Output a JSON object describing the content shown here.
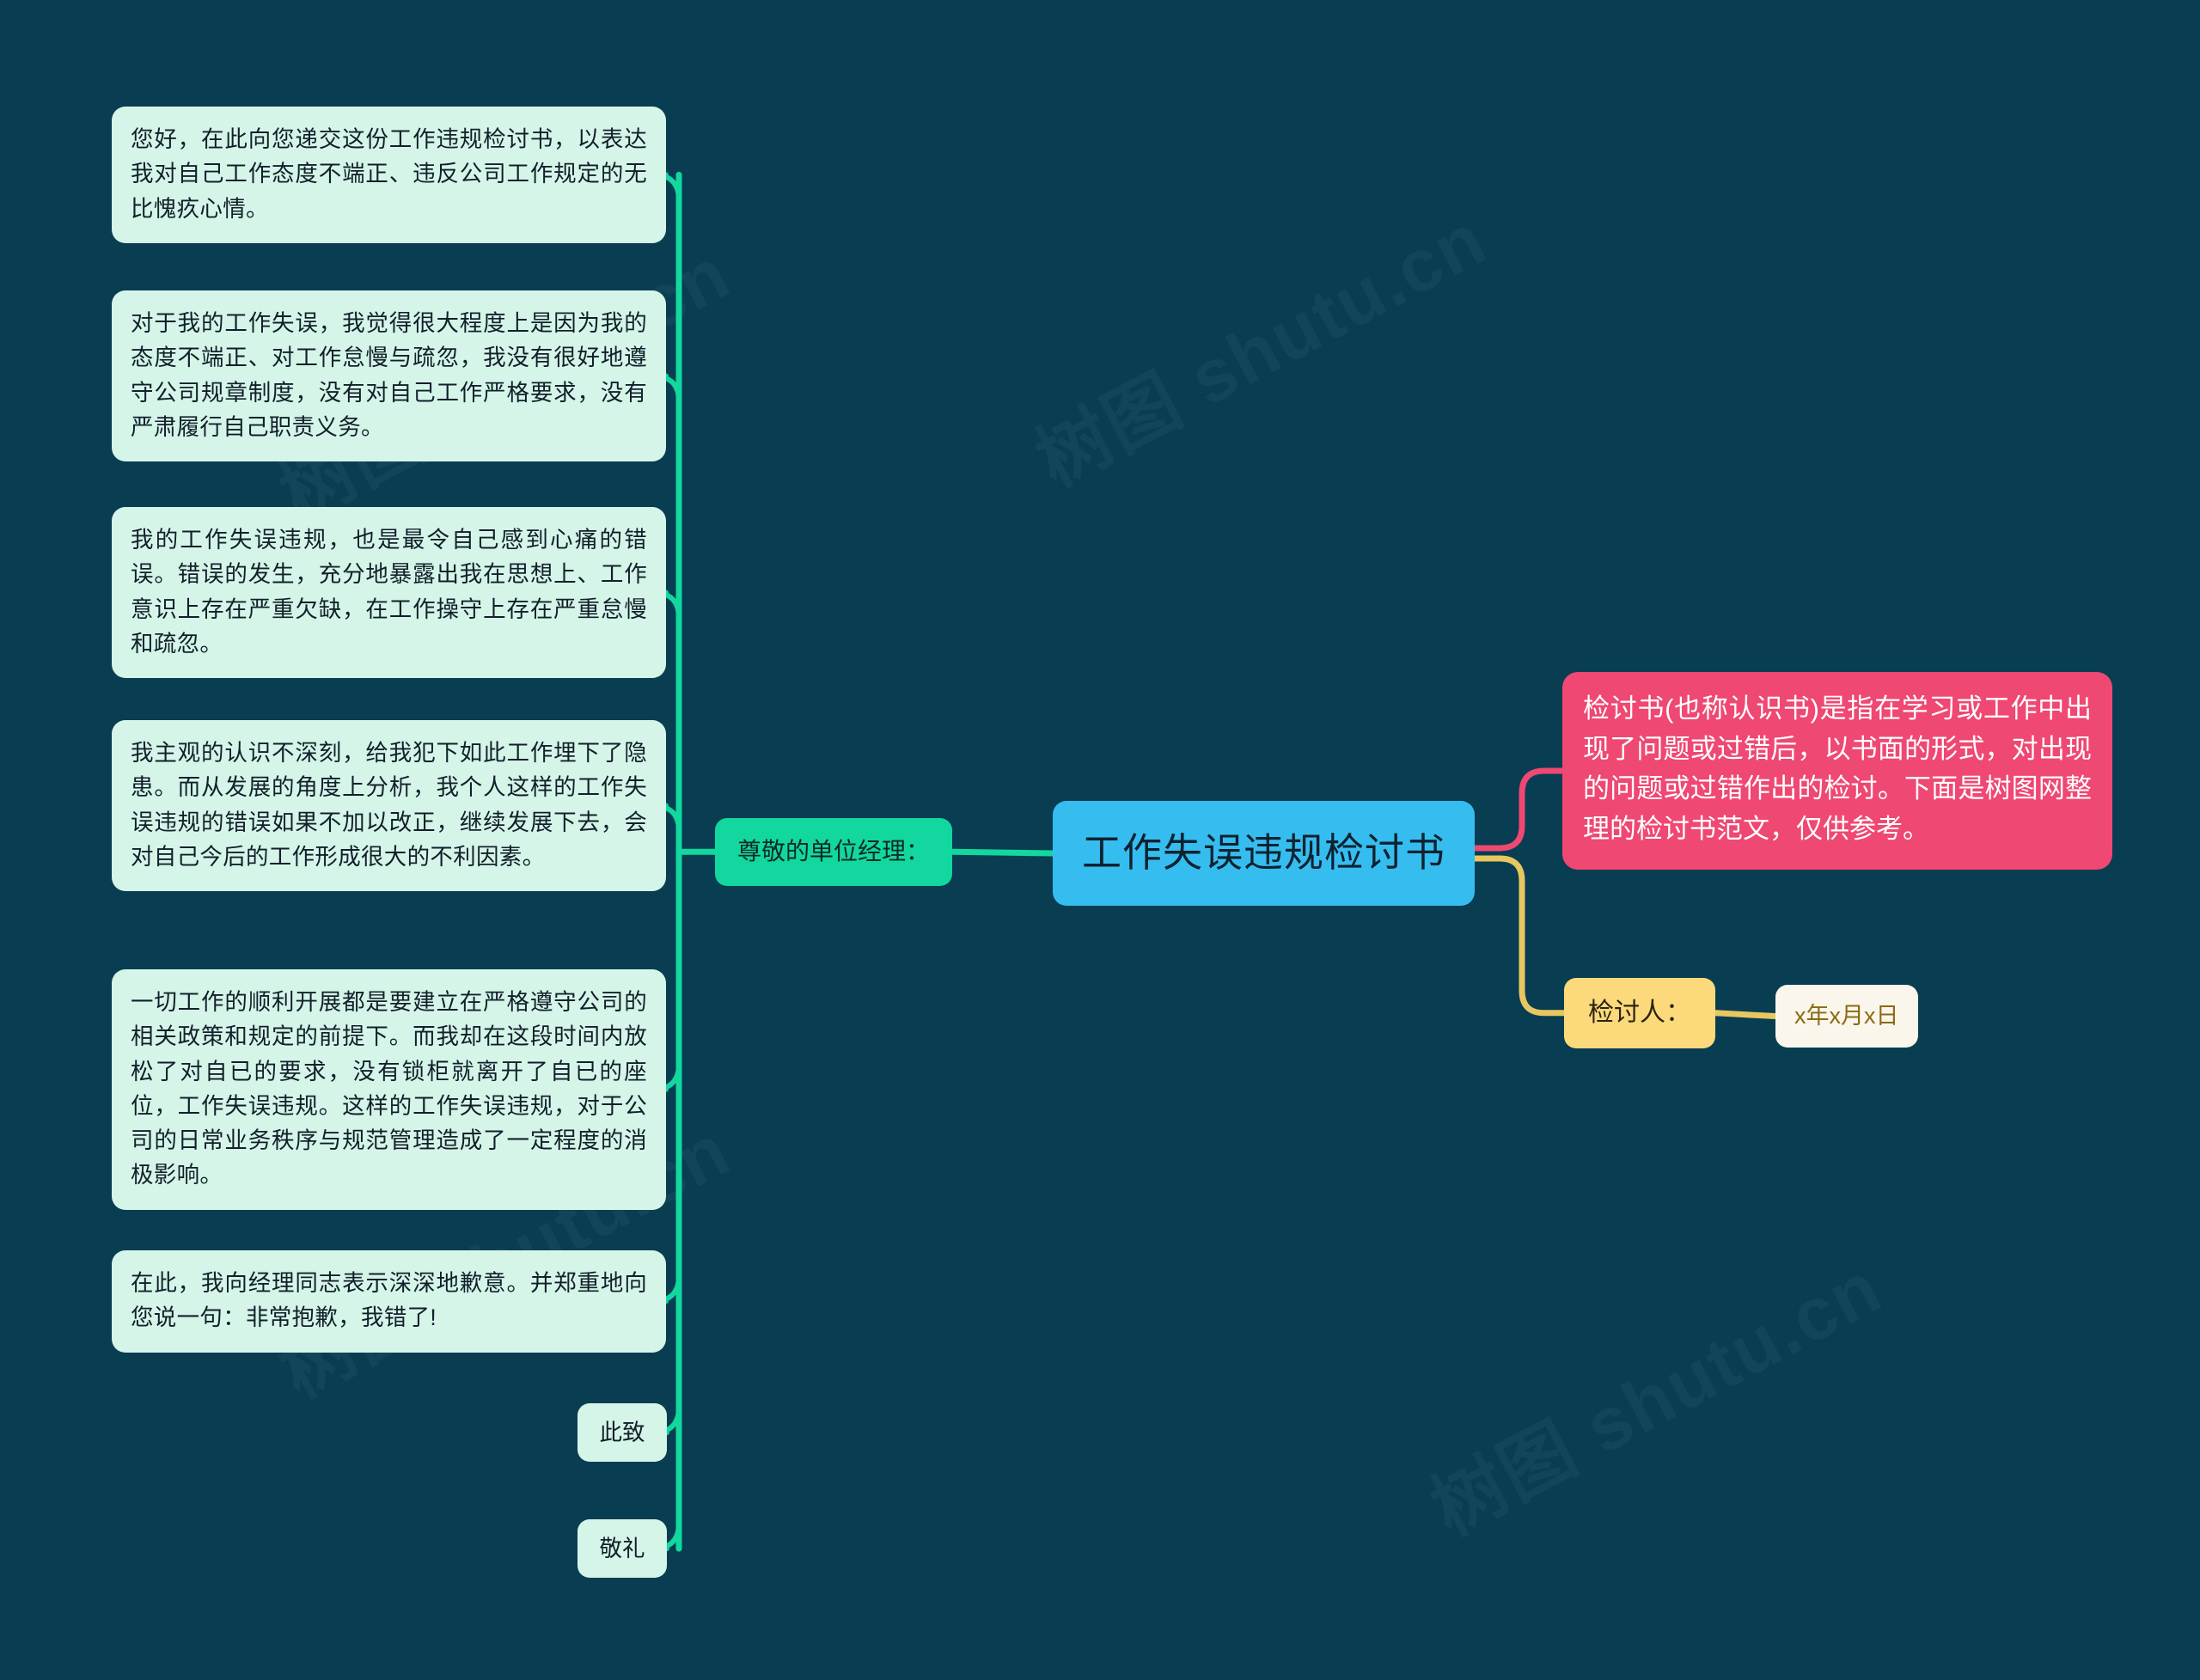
{
  "canvas": {
    "background_color": "#083d52",
    "watermark_text": "树图 shutu.cn"
  },
  "palette": {
    "background": "#083d52",
    "root_fill": "#36bdf0",
    "branch_fill": "#12d79e",
    "leaf_fill": "#d6f5e9",
    "pink_fill": "#ef4872",
    "yellow_fill": "#fcd97a",
    "cream_fill": "#fbf6ec",
    "green_link": "#12d79e",
    "pink_link": "#ef4872",
    "yellow_link": "#e8c760"
  },
  "root": {
    "label": "工作失误违规检讨书"
  },
  "left_branch": {
    "label": "尊敬的单位经理：",
    "children": [
      {
        "label": "您好，在此向您递交这份工作违规检讨书，以表达我对自己工作态度不端正、违反公司工作规定的无比愧疚心情。"
      },
      {
        "label": "对于我的工作失误，我觉得很大程度上是因为我的态度不端正、对工作怠慢与疏忽，我没有很好地遵守公司规章制度，没有对自己工作严格要求，没有严肃履行自己职责义务。"
      },
      {
        "label": "我的工作失误违规，也是最令自己感到心痛的错误。错误的发生，充分地暴露出我在思想上、工作意识上存在严重欠缺，在工作操守上存在严重怠慢和疏忽。"
      },
      {
        "label": "我主观的认识不深刻，给我犯下如此工作埋下了隐患。而从发展的角度上分析，我个人这样的工作失误违规的错误如果不加以改正，继续发展下去，会对自己今后的工作形成很大的不利因素。"
      },
      {
        "label": "一切工作的顺利开展都是要建立在严格遵守公司的相关政策和规定的前提下。而我却在这段时间内放松了对自已的要求，没有锁柜就离开了自已的座位，工作失误违规。这样的工作失误违规，对于公司的日常业务秩序与规范管理造成了一定程度的消极影响。"
      },
      {
        "label": "在此，我向经理同志表示深深地歉意。并郑重地向您说一句：非常抱歉，我错了!"
      },
      {
        "label": "此致"
      },
      {
        "label": "敬礼"
      }
    ]
  },
  "right_branches": [
    {
      "label": "检讨书(也称认识书)是指在学习或工作中出现了问题或过错后，以书面的形式，对出现的问题或过错作出的检讨。下面是树图网整理的检讨书范文，仅供参考。"
    },
    {
      "label": "检讨人：",
      "child": {
        "label": "x年x月x日"
      }
    }
  ]
}
